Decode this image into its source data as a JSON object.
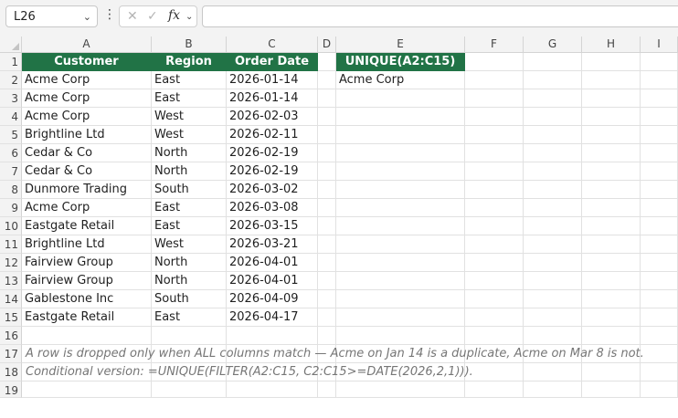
{
  "name_box": {
    "value": "L26"
  },
  "formula_bar": {
    "value": ""
  },
  "columns": [
    "A",
    "B",
    "C",
    "D",
    "E",
    "F",
    "G",
    "H",
    "I"
  ],
  "rows": [
    "1",
    "2",
    "3",
    "4",
    "5",
    "6",
    "7",
    "8",
    "9",
    "10",
    "11",
    "12",
    "13",
    "14",
    "15",
    "16",
    "17",
    "18",
    "19"
  ],
  "headers": {
    "customer": "Customer",
    "region": "Region",
    "order_date": "Order Date",
    "unique": "UNIQUE(A2:C15)"
  },
  "data": [
    [
      "Acme Corp",
      "East",
      "2026-01-14"
    ],
    [
      "Acme Corp",
      "East",
      "2026-01-14"
    ],
    [
      "Acme Corp",
      "West",
      "2026-02-03"
    ],
    [
      "Brightline Ltd",
      "West",
      "2026-02-11"
    ],
    [
      "Cedar & Co",
      "North",
      "2026-02-19"
    ],
    [
      "Cedar & Co",
      "North",
      "2026-02-19"
    ],
    [
      "Dunmore Trading",
      "South",
      "2026-03-02"
    ],
    [
      "Acme Corp",
      "East",
      "2026-03-08"
    ],
    [
      "Eastgate Retail",
      "East",
      "2026-03-15"
    ],
    [
      "Brightline Ltd",
      "West",
      "2026-03-21"
    ],
    [
      "Fairview Group",
      "North",
      "2026-04-01"
    ],
    [
      "Fairview Group",
      "North",
      "2026-04-01"
    ],
    [
      "Gablestone Inc",
      "South",
      "2026-04-09"
    ],
    [
      "Eastgate Retail",
      "East",
      "2026-04-17"
    ]
  ],
  "unique_result": [
    "Acme Corp"
  ],
  "notes": [
    "A row is dropped only when ALL columns match — Acme on Jan 14 is a duplicate, Acme on Mar 8 is not.",
    "Conditional version: =UNIQUE(FILTER(A2:C15, C2:C15>=DATE(2026,2,1)))."
  ],
  "colors": {
    "header_fill": "#217346",
    "header_text": "#ffffff",
    "note_text": "#767676"
  }
}
